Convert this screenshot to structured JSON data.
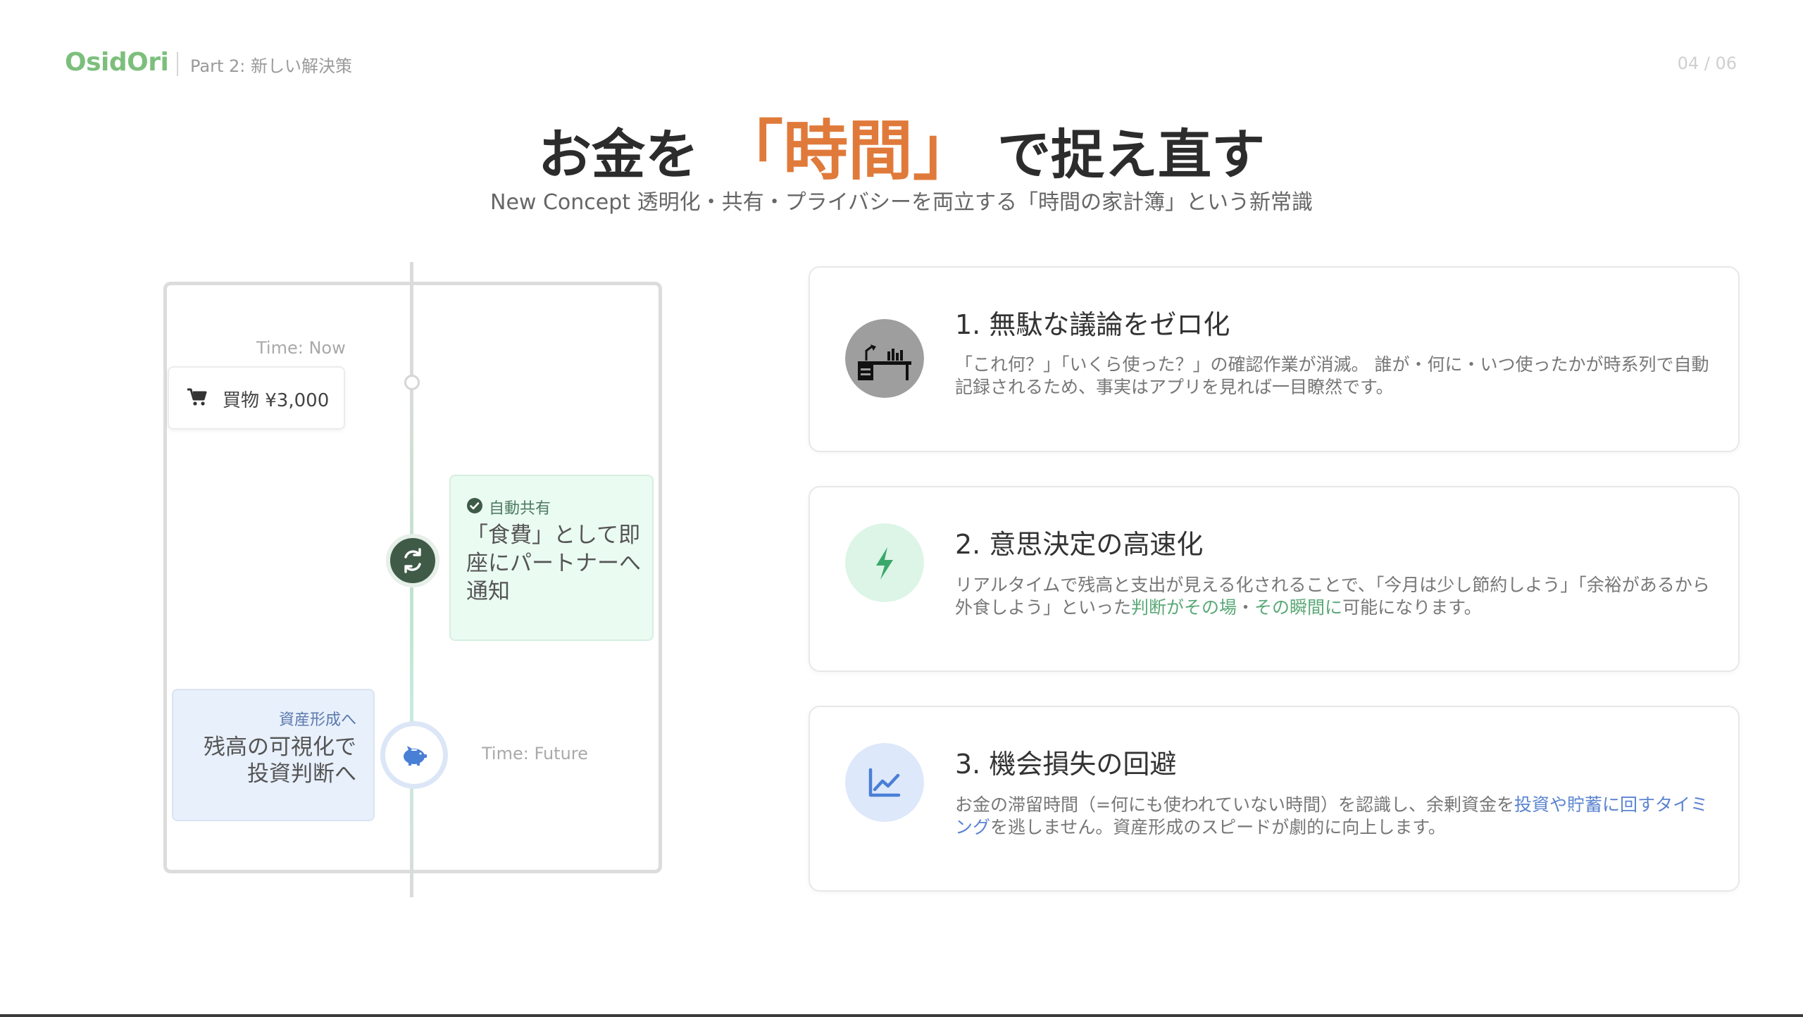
{
  "header": {
    "logo": "OsidOri",
    "section": "Part 2: 新しい解決策",
    "page": "04 / 06"
  },
  "title": {
    "before": "お金を",
    "highlight": "「時間」",
    "after": "で捉え直す"
  },
  "subtitle": "New Concept 透明化・共有・プライバシーを両立する「時間の家計簿」という新常識",
  "timeline": {
    "time_now": "Time: Now",
    "purchase": "買物 ¥3,000",
    "share_label": "自動共有",
    "share_text": "「食費」として即座にパートナーへ通知",
    "asset_label": "資産形成へ",
    "asset_text_line1": "残高の可視化で",
    "asset_text_line2": "投資判断へ",
    "time_future": "Time: Future"
  },
  "features": [
    {
      "title": "1. 無駄な議論をゼロ化",
      "desc": "「これ何？」「いくら使った？」の確認作業が消滅。 誰が・何に・いつ使ったかが時系列で自動記録されるため、事実はアプリを見れば一目瞭然です。",
      "icon": "desk-icon"
    },
    {
      "title": "2. 意思決定の高速化",
      "desc_pre": "リアルタイムで残高と支出が見える化されることで、「今月は少し節約しよう」「余裕があるから外食しよう」といった",
      "desc_hl1": "判断がその場",
      "desc_mid": "・",
      "desc_hl2": "その瞬間に",
      "desc_post": "可能になります。",
      "icon": "lightning-icon"
    },
    {
      "title": "3. 機会損失の回避",
      "desc_pre": "お金の滞留時間（=何にも使われていない時間）を認識し、余剰資金を",
      "desc_hl": "投資や貯蓄に回すタイミング",
      "desc_post": "を逃しません。資産形成のスピードが劇的に向上します。",
      "icon": "chart-line-icon"
    }
  ],
  "colors": {
    "accent_orange": "#e07a3a",
    "brand_green": "#7cbf7c",
    "highlight_green": "#5aa877",
    "highlight_blue": "#5b84d0"
  }
}
